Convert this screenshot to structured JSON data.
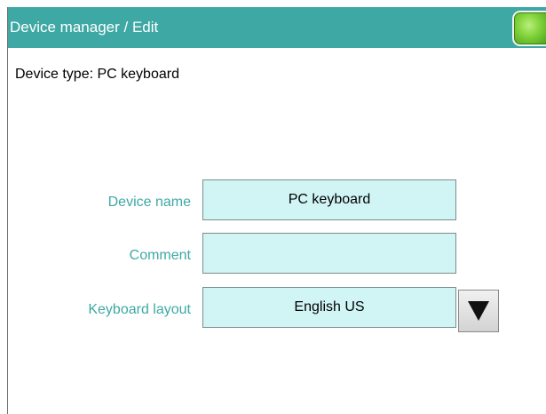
{
  "window": {
    "title": "Device manager / Edit",
    "home_button_icon": "green-home-button-icon"
  },
  "main": {
    "device_type": "Device type: PC keyboard",
    "fields": {
      "device_name": {
        "label": "Device name",
        "value": "PC keyboard"
      },
      "comment": {
        "label": "Comment",
        "value": ""
      },
      "keyboard_layout": {
        "label": "Keyboard layout",
        "value": "English US",
        "dropdown_icon": "triangle-down-icon"
      }
    }
  },
  "colors": {
    "titlebar": "#3ea9a4",
    "label_accent": "#3ea9a4",
    "field_background": "#d1f5f5",
    "home_button": "#7fd13a"
  }
}
